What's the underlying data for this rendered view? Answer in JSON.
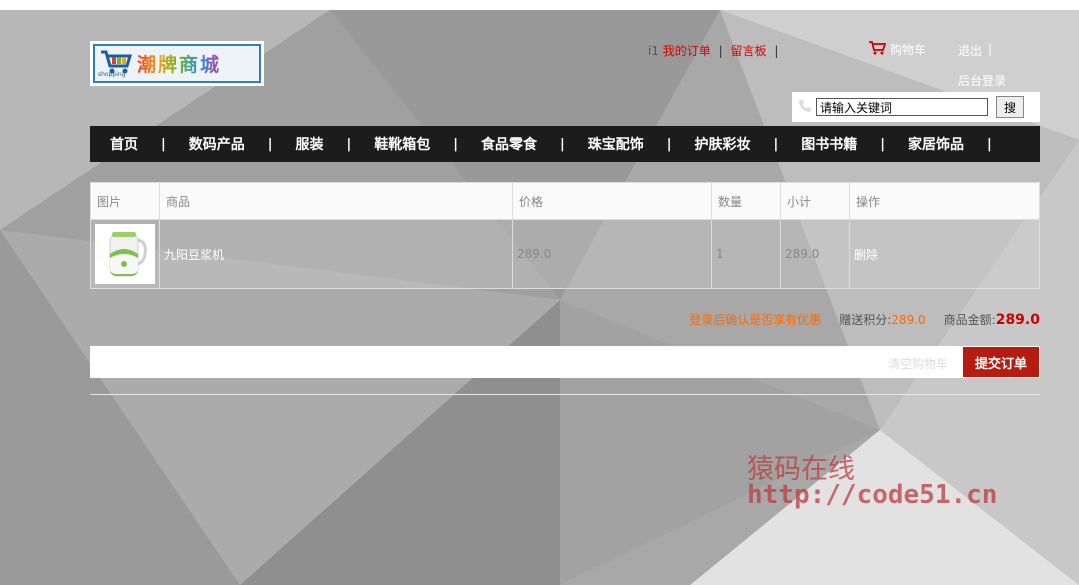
{
  "logo": {
    "text": "潮牌商城",
    "sub": "shopping"
  },
  "topnav": {
    "prefix": "i1",
    "my_orders": "我的订单",
    "guestbook": "留言板",
    "separator": "|",
    "cart": "购物车",
    "logout": "退出",
    "admin_login": "后台登录"
  },
  "search": {
    "value": "请输入关键词",
    "button": "搜"
  },
  "nav": {
    "items": [
      "首页",
      "数码产品",
      "服装",
      "鞋靴箱包",
      "食品零食",
      "珠宝配饰",
      "护肤彩妆",
      "图书书籍",
      "家居饰品"
    ],
    "separator": "|"
  },
  "cart_table": {
    "headers": [
      "图片",
      "商品",
      "价格",
      "数量",
      "小计",
      "操作"
    ],
    "rows": [
      {
        "name": "九阳豆浆机",
        "price": "289.0",
        "qty": "1",
        "subtotal": "289.0",
        "action": "删除"
      }
    ]
  },
  "summary": {
    "login_tip": "登录后确认是否享有优惠",
    "points_label": "赠送积分:",
    "points_value": "289.0",
    "amount_label": "商品金额:",
    "amount_value": "289.0"
  },
  "actions": {
    "clear": "清空购物车",
    "submit": "提交订单"
  },
  "watermark": {
    "line1": "猿码在线",
    "line2": "http://code51.cn"
  },
  "colors": {
    "nav_bg": "#1c1c1c",
    "submit_bg": "#b61d10",
    "highlight": "#ff6a00",
    "total": "#c00000"
  }
}
